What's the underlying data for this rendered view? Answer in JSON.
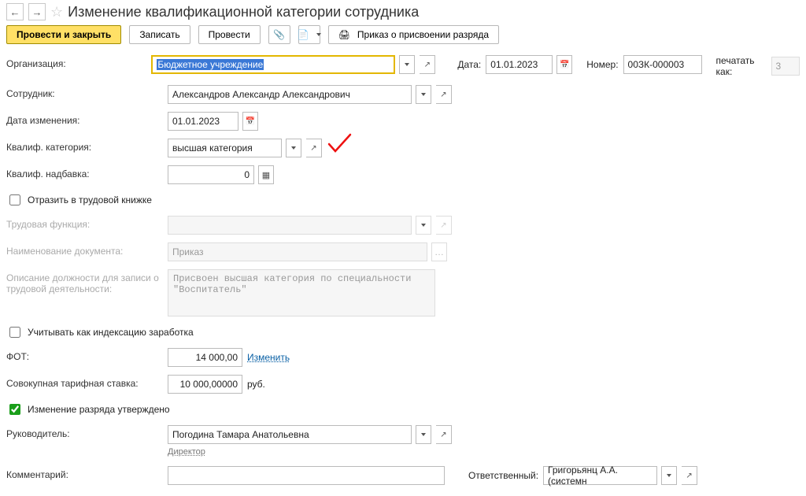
{
  "title": "Изменение квалификационной категории сотрудника",
  "toolbar": {
    "post_close": "Провести и закрыть",
    "save": "Записать",
    "post": "Провести",
    "order": "Приказ о присвоении разряда"
  },
  "labels": {
    "org": "Организация:",
    "date": "Дата:",
    "number": "Номер:",
    "print_as": "печатать как:",
    "employee": "Сотрудник:",
    "change_date": "Дата изменения:",
    "category": "Квалиф. категория:",
    "allowance": "Квалиф. надбавка:",
    "workbook": "Отразить в трудовой книжке",
    "labor_func": "Трудовая функция:",
    "doc_name": "Наименование документа:",
    "position_desc": "Описание должности для записи о трудовой деятельности:",
    "indexation": "Учитывать как индексацию заработка",
    "fot": "ФОТ:",
    "fot_change": "Изменить",
    "tariff": "Совокупная тарифная ставка:",
    "tariff_unit": "руб.",
    "approved": "Изменение разряда утверждено",
    "manager": "Руководитель:",
    "manager_title": "Директор",
    "comment": "Комментарий:",
    "responsible": "Ответственный:"
  },
  "values": {
    "org": "Бюджетное учреждение",
    "date": "01.01.2023",
    "number": "00ЗК-000003",
    "print_as": "3",
    "employee": "Александров Александр Александрович",
    "change_date": "01.01.2023",
    "category": "высшая категория",
    "allowance": "0",
    "doc_name": "Приказ",
    "position_desc": "Присвоен высшая категория по специальности \"Воспитатель\"",
    "fot": "14 000,00",
    "tariff": "10 000,00000",
    "manager": "Погодина Тамара Анатольевна",
    "responsible": "Григорьянц А.А. (системн"
  }
}
